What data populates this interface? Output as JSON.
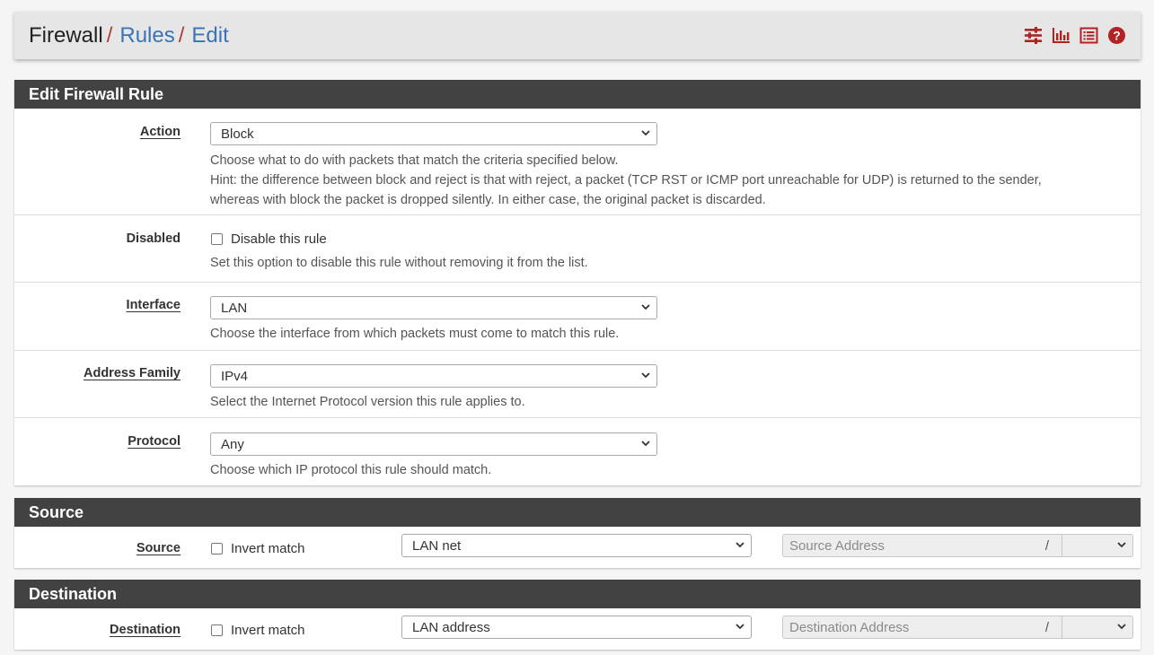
{
  "breadcrumb": {
    "items": [
      {
        "label": "Firewall",
        "link": false
      },
      {
        "label": "Rules",
        "link": true
      },
      {
        "label": "Edit",
        "link": true
      }
    ],
    "separator": "/"
  },
  "header_icons": [
    "settings-sliders-icon",
    "bar-chart-icon",
    "list-icon",
    "help-icon"
  ],
  "accent_color": "#b22222",
  "edit_panel": {
    "title": "Edit Firewall Rule",
    "action": {
      "label": "Action",
      "value": "Block",
      "help1": "Choose what to do with packets that match the criteria specified below.",
      "help2": "Hint: the difference between block and reject is that with reject, a packet (TCP RST or ICMP port unreachable for UDP) is returned to the sender,",
      "help3": "whereas with block the packet is dropped silently. In either case, the original packet is discarded."
    },
    "disabled": {
      "label": "Disabled",
      "checkbox_label": "Disable this rule",
      "help": "Set this option to disable this rule without removing it from the list."
    },
    "interface": {
      "label": "Interface",
      "value": "LAN",
      "help": "Choose the interface from which packets must come to match this rule."
    },
    "address_family": {
      "label": "Address Family",
      "value": "IPv4",
      "help": "Select the Internet Protocol version this rule applies to."
    },
    "protocol": {
      "label": "Protocol",
      "value": "Any",
      "help": "Choose which IP protocol this rule should match."
    }
  },
  "source_panel": {
    "title": "Source",
    "label": "Source",
    "invert_label": "Invert match",
    "type_value": "LAN net",
    "address_placeholder": "Source Address",
    "separator": "/"
  },
  "destination_panel": {
    "title": "Destination",
    "label": "Destination",
    "invert_label": "Invert match",
    "type_value": "LAN address",
    "address_placeholder": "Destination Address",
    "separator": "/"
  }
}
